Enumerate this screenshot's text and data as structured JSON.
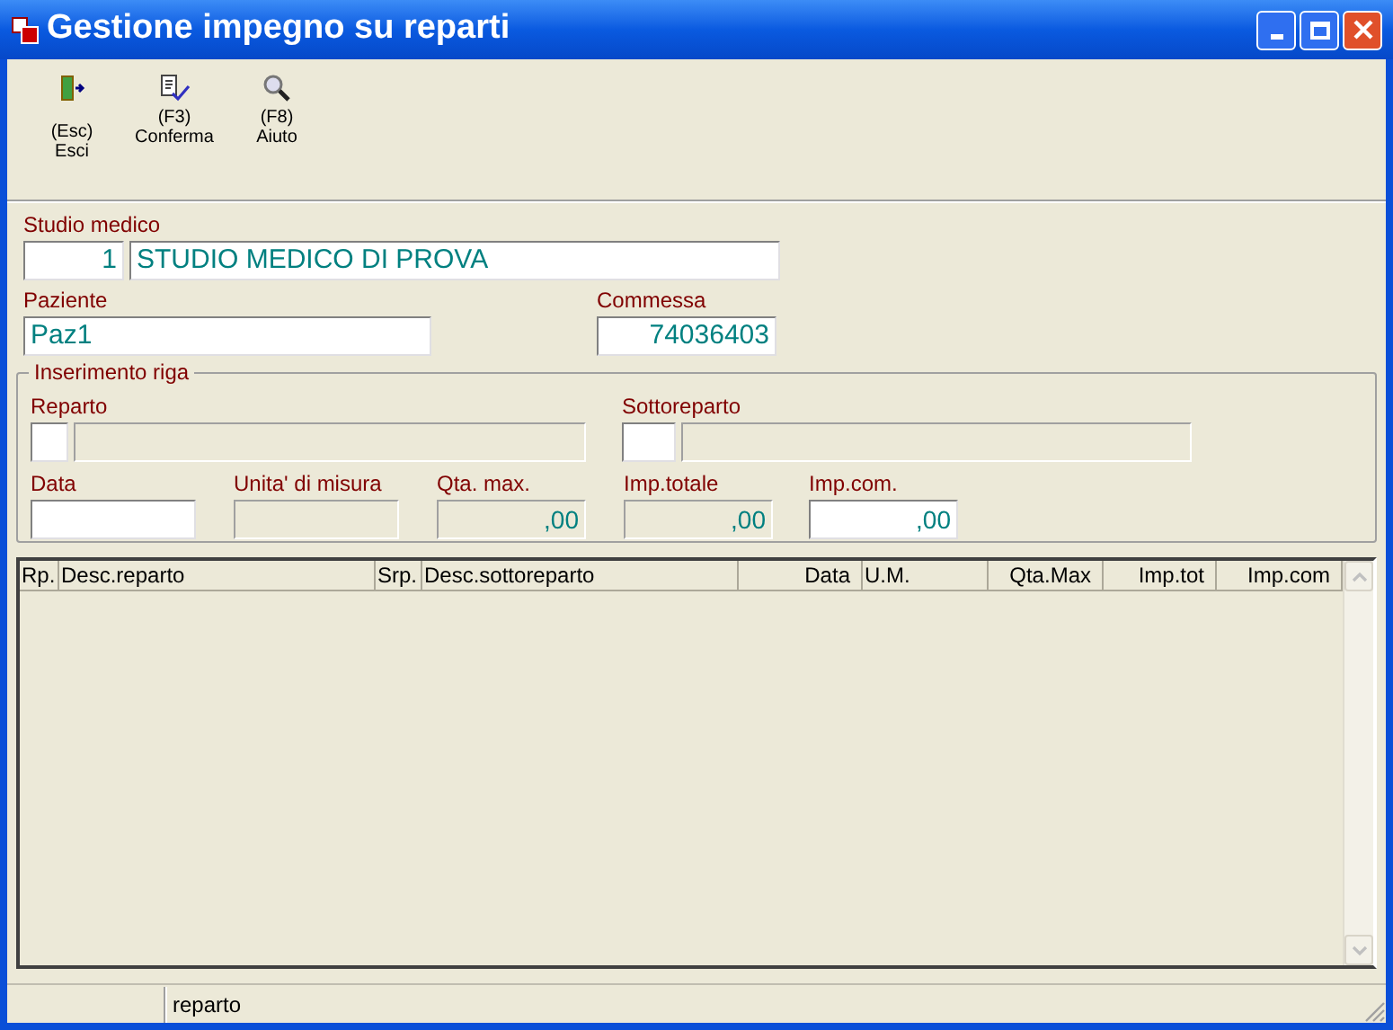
{
  "window": {
    "title": "Gestione impegno su reparti"
  },
  "toolbar": [
    {
      "key": "(Esc)",
      "label": "Esci",
      "kind": "exit"
    },
    {
      "key": "(F3)",
      "label": "Conferma",
      "kind": "confirm"
    },
    {
      "key": "(F8)",
      "label": "Aiuto",
      "kind": "help"
    }
  ],
  "studio": {
    "label": "Studio medico",
    "code": "1",
    "name": "STUDIO MEDICO DI PROVA"
  },
  "paziente": {
    "label": "Paziente",
    "value": "Paz1"
  },
  "commessa": {
    "label": "Commessa",
    "value": "74036403"
  },
  "inserimento": {
    "title": "Inserimento riga",
    "reparto": {
      "label": "Reparto"
    },
    "sottoreparto": {
      "label": "Sottoreparto"
    },
    "fields": [
      {
        "label": "Data",
        "disabled": false
      },
      {
        "label": "Unita' di misura",
        "disabled": true
      },
      {
        "label": "Qta. max.",
        "value": ",00",
        "disabled": true
      },
      {
        "label": "Imp.totale",
        "value": ",00",
        "disabled": true
      },
      {
        "label": "Imp.com.",
        "value": ",00",
        "disabled": false
      }
    ]
  },
  "table": {
    "columns": [
      "Rp.",
      "Desc.reparto",
      "Srp.",
      "Desc.sottoreparto",
      "Data",
      "U.M.",
      "Qta.Max",
      "Imp.tot",
      "Imp.com"
    ]
  },
  "status_bar": {
    "field_2": "reparto"
  }
}
